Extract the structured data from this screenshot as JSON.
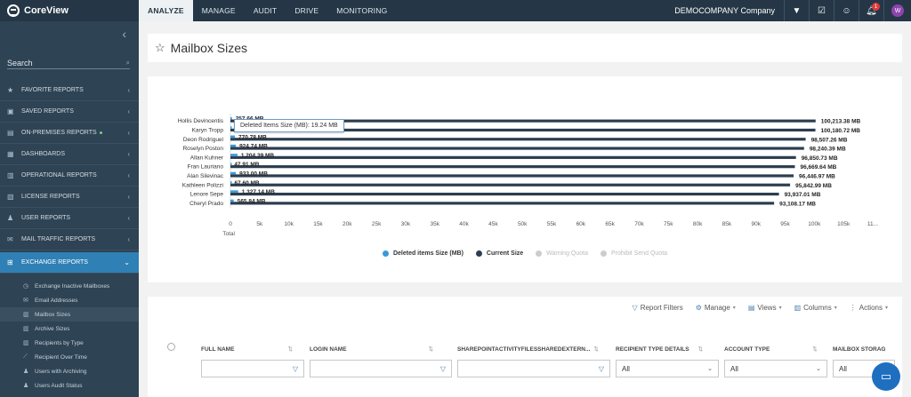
{
  "topbar": {
    "logo_text": "CoreView",
    "nav": [
      "ANALYZE",
      "MANAGE",
      "AUDIT",
      "DRIVE",
      "MONITORING"
    ],
    "active_nav": "ANALYZE",
    "company": "DEMOCOMPANY Company",
    "notification_count": "1",
    "avatar_initial": "W"
  },
  "sidebar": {
    "search_label": "Search",
    "sections": [
      {
        "label": "FAVORITE REPORTS",
        "icon": "star-icon"
      },
      {
        "label": "SAVED REPORTS",
        "icon": "save-icon"
      },
      {
        "label": "ON-PREMISES REPORTS",
        "icon": "server-icon"
      },
      {
        "label": "DASHBOARDS",
        "icon": "dashboard-icon"
      },
      {
        "label": "OPERATIONAL REPORTS",
        "icon": "report-icon"
      },
      {
        "label": "LICENSE REPORTS",
        "icon": "license-icon"
      },
      {
        "label": "USER REPORTS",
        "icon": "user-icon"
      },
      {
        "label": "MAIL TRAFFIC REPORTS",
        "icon": "mail-icon"
      },
      {
        "label": "EXCHANGE REPORTS",
        "icon": "exchange-icon"
      }
    ],
    "sub_items": [
      "Exchange Inactive Mailboxes",
      "Email Addresses",
      "Mailbox Sizes",
      "Archive Sizes",
      "Recipients by Type",
      "Recipient Over Time",
      "Users with Archiving",
      "Users Audit Status"
    ],
    "active_sub": "Mailbox Sizes"
  },
  "page": {
    "title": "Mailbox Sizes"
  },
  "tooltip": {
    "text": "Deleted Items Size (MB): 19.24 MB"
  },
  "chart_data": {
    "type": "bar",
    "orientation": "horizontal",
    "categories": [
      "Hollis Devincentis",
      "Karyn Tropp",
      "Deon Rodriguel",
      "Roselyn Poston",
      "Allan Kuhner",
      "Fran Lauriano",
      "Alan Silevinac",
      "Kathleen Polizzi",
      "Lenore Sepe",
      "Cheryl Prado"
    ],
    "series": [
      {
        "name": "Deleted items Size (MB)",
        "color": "#3a9ad9",
        "values": [
          257.66,
          19.24,
          770.78,
          924.74,
          1204.39,
          47.91,
          933.0,
          67.6,
          1327.14,
          565.84
        ],
        "labels": [
          "257.66 MB",
          "",
          "770.78 MB",
          "924.74 MB",
          "1,204.39 MB",
          "47.91 MB",
          "933.00 MB",
          "67.60 MB",
          "1,327.14 MB",
          "565.84 MB"
        ]
      },
      {
        "name": "Current Size",
        "color": "#2c3e50",
        "values": [
          100213.38,
          100180.72,
          98507.26,
          98240.39,
          96850.73,
          96669.64,
          96446.97,
          95842.99,
          93937.01,
          93108.17
        ],
        "labels": [
          "100,213.38 MB",
          "100,180.72 MB",
          "98,507.26 MB",
          "98,240.39 MB",
          "96,850.73 MB",
          "96,669.64 MB",
          "96,446.97 MB",
          "95,842.99 MB",
          "93,937.01 MB",
          "93,108.17 MB"
        ]
      },
      {
        "name": "Warning Quota",
        "color": "#cccccc",
        "values": []
      },
      {
        "name": "Prohibit Send Quota",
        "color": "#cccccc",
        "values": []
      }
    ],
    "x_ticks": [
      "0",
      "5k",
      "10k",
      "15k",
      "20k",
      "25k",
      "30k",
      "35k",
      "40k",
      "45k",
      "50k",
      "55k",
      "60k",
      "65k",
      "70k",
      "75k",
      "80k",
      "85k",
      "90k",
      "95k",
      "100k",
      "105k",
      "11..."
    ],
    "xlabel": "Total",
    "xlim": [
      0,
      110000
    ],
    "legend_position": "bottom"
  },
  "grid": {
    "toolbar": [
      "Report Filters",
      "Manage",
      "Views",
      "Columns",
      "Actions"
    ],
    "columns": [
      "FULL NAME",
      "LOGIN NAME",
      "SHAREPOINTACTIVITYFILESSHAREDEXTERN...",
      "RECIPIENT TYPE DETAILS",
      "ACCOUNT TYPE",
      "MAILBOX STORAG"
    ],
    "filter_all": "All"
  }
}
